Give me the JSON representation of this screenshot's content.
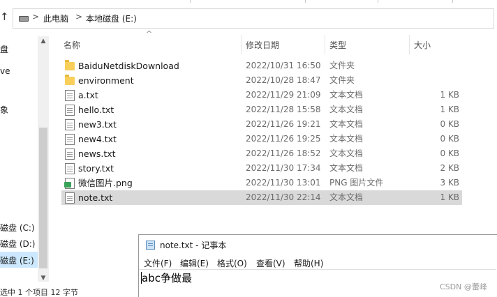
{
  "address_bar": {
    "breadcrumbs": [
      "此电脑",
      "本地磁盘 (E:)"
    ],
    "separator": ">"
  },
  "nav_pane": {
    "items": [
      "盘",
      "ve",
      "象",
      "磁盘 (C:)",
      "磁盘 (D:)",
      "磁盘 (E:)"
    ],
    "selected_index": 5
  },
  "columns": {
    "name": "名称",
    "date": "修改日期",
    "type": "类型",
    "size": "大小"
  },
  "files": [
    {
      "name": "BaiduNetdiskDownload",
      "date": "2022/10/31 16:50",
      "type": "文件夹",
      "size": "",
      "icon": "folder-icon"
    },
    {
      "name": "environment",
      "date": "2022/10/28 18:47",
      "type": "文件夹",
      "size": "",
      "icon": "folder-icon"
    },
    {
      "name": "a.txt",
      "date": "2022/11/29 21:09",
      "type": "文本文档",
      "size": "1 KB",
      "icon": "text-file-icon"
    },
    {
      "name": "hello.txt",
      "date": "2022/11/28 15:58",
      "type": "文本文档",
      "size": "1 KB",
      "icon": "text-file-icon"
    },
    {
      "name": "new3.txt",
      "date": "2022/11/26 19:21",
      "type": "文本文档",
      "size": "0 KB",
      "icon": "text-file-icon"
    },
    {
      "name": "new4.txt",
      "date": "2022/11/26 19:25",
      "type": "文本文档",
      "size": "0 KB",
      "icon": "text-file-icon"
    },
    {
      "name": "news.txt",
      "date": "2022/11/26 18:52",
      "type": "文本文档",
      "size": "0 KB",
      "icon": "text-file-icon"
    },
    {
      "name": "story.txt",
      "date": "2022/11/30 17:34",
      "type": "文本文档",
      "size": "2 KB",
      "icon": "text-file-icon"
    },
    {
      "name": "微信图片.png",
      "date": "2022/11/30 13:01",
      "type": "PNG 图片文件",
      "size": "3 KB",
      "icon": "png-file-icon"
    },
    {
      "name": "note.txt",
      "date": "2022/11/30 22:14",
      "type": "文本文档",
      "size": "1 KB",
      "icon": "text-file-icon"
    }
  ],
  "selected_file_index": 9,
  "status_bar": "选中 1 个项目  12 字节",
  "notepad": {
    "title": "note.txt - 记事本",
    "menu": [
      "文件(F)",
      "编辑(E)",
      "格式(O)",
      "查看(V)",
      "帮助(H)"
    ],
    "content": "abc争做最"
  },
  "watermark": "CSDN @蕾峰",
  "colors": {
    "selection": "#d9d9d9",
    "nav_selection": "#cce8ff",
    "folder": "#f8cf5a"
  }
}
